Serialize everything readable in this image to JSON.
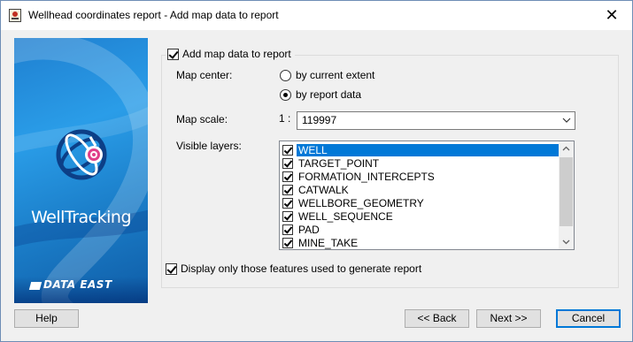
{
  "window": {
    "title": "Wellhead coordinates report - Add map data to report",
    "close_glyph": "✕"
  },
  "banner": {
    "product_name": "WellTracking",
    "company": "DATA EAST"
  },
  "group": {
    "checkbox_label": "Add map data to report",
    "checked": true
  },
  "map_center": {
    "label": "Map center:",
    "options": [
      {
        "label": "by current extent",
        "selected": false
      },
      {
        "label": "by report data",
        "selected": true
      }
    ]
  },
  "map_scale": {
    "label": "Map scale:",
    "prefix": "1 :",
    "value": "119997"
  },
  "visible_layers": {
    "label": "Visible layers:",
    "items": [
      {
        "name": "WELL",
        "checked": true,
        "selected": true
      },
      {
        "name": "TARGET_POINT",
        "checked": true,
        "selected": false
      },
      {
        "name": "FORMATION_INTERCEPTS",
        "checked": true,
        "selected": false
      },
      {
        "name": "CATWALK",
        "checked": true,
        "selected": false
      },
      {
        "name": "WELLBORE_GEOMETRY",
        "checked": true,
        "selected": false
      },
      {
        "name": "WELL_SEQUENCE",
        "checked": true,
        "selected": false
      },
      {
        "name": "PAD",
        "checked": true,
        "selected": false
      },
      {
        "name": "MINE_TAKE",
        "checked": true,
        "selected": false
      }
    ]
  },
  "display_only": {
    "label": "Display only those features used to generate report",
    "checked": true
  },
  "buttons": {
    "help": "Help",
    "back": "<< Back",
    "next": "Next >>",
    "cancel": "Cancel"
  },
  "colors": {
    "selection": "#0078d7",
    "banner_blue": "#1f7fd0",
    "dialog_bg": "#f0f0f0"
  }
}
